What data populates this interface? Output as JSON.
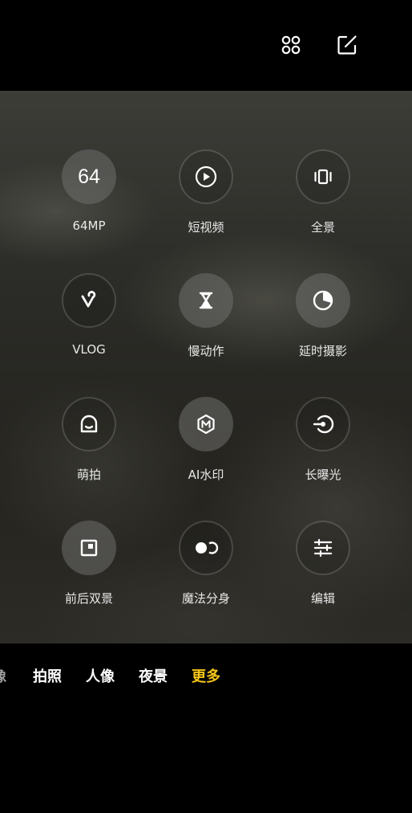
{
  "topbar": {
    "icons": [
      {
        "name": "grid-icon"
      },
      {
        "name": "edit-icon"
      }
    ]
  },
  "modes": [
    {
      "label": "64MP",
      "glyph": "64",
      "icon": "64mp-icon"
    },
    {
      "label": "短视频",
      "icon": "play-icon"
    },
    {
      "label": "全景",
      "icon": "panorama-icon"
    },
    {
      "label": "VLOG",
      "icon": "vlog-icon"
    },
    {
      "label": "慢动作",
      "icon": "hourglass-icon"
    },
    {
      "label": "延时摄影",
      "icon": "timelapse-icon"
    },
    {
      "label": "萌拍",
      "icon": "cute-face-icon"
    },
    {
      "label": "AI水印",
      "icon": "ai-watermark-icon"
    },
    {
      "label": "长曝光",
      "icon": "long-exposure-icon"
    },
    {
      "label": "前后双景",
      "icon": "dual-view-icon"
    },
    {
      "label": "魔法分身",
      "icon": "clone-icon"
    },
    {
      "label": "编辑",
      "icon": "sliders-icon"
    }
  ],
  "tabs": [
    {
      "label": "像",
      "state": "partial"
    },
    {
      "label": "拍照"
    },
    {
      "label": "人像"
    },
    {
      "label": "夜景"
    },
    {
      "label": "更多",
      "state": "active"
    }
  ],
  "colors": {
    "accent": "#f5c518",
    "background": "#000000"
  }
}
